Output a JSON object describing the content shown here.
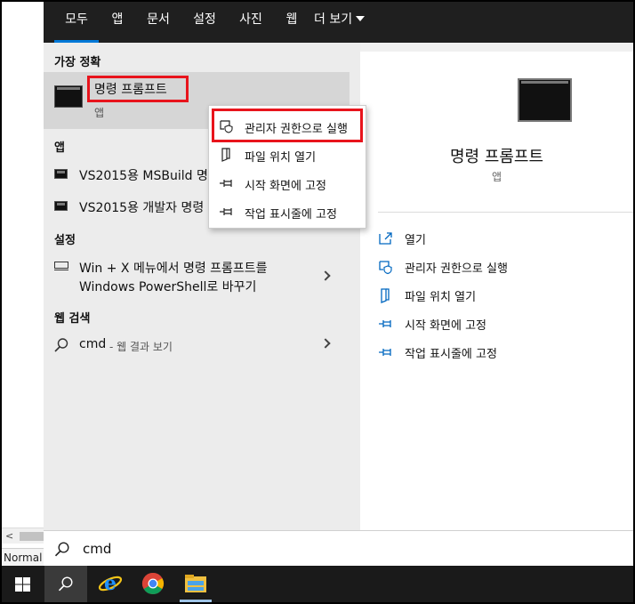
{
  "background_doc": {
    "scroll_left": "<",
    "status_text": "Normal t"
  },
  "tabs": [
    "모두",
    "앱",
    "문서",
    "설정",
    "사진",
    "웹",
    "더 보기"
  ],
  "left": {
    "best_match_title": "가장 정확",
    "best_match": {
      "name": "명령 프롬프트",
      "type": "앱"
    },
    "apps_title": "앱",
    "apps": [
      "VS2015용 MSBuild 명",
      "VS2015용 개발자 명령"
    ],
    "settings_title": "설정",
    "setting_line1": "Win + X 메뉴에서 명령 프롬프트를",
    "setting_line2": "Windows PowerShell로 바꾸기",
    "web_title": "웹 검색",
    "web_query": "cmd",
    "web_hint": "- 웹 결과 보기"
  },
  "context_menu": [
    "관리자 권한으로 실행",
    "파일 위치 열기",
    "시작 화면에 고정",
    "작업 표시줄에 고정"
  ],
  "preview": {
    "title": "명령 프롬프트",
    "subtitle": "앱",
    "actions": [
      {
        "label": "열기",
        "icon": "open-icon"
      },
      {
        "label": "관리자 권한으로 실행",
        "icon": "shield-icon"
      },
      {
        "label": "파일 위치 열기",
        "icon": "file-location-icon"
      },
      {
        "label": "시작 화면에 고정",
        "icon": "pin-icon"
      },
      {
        "label": "작업 표시줄에 고정",
        "icon": "pin-icon"
      }
    ]
  },
  "search": {
    "query": "cmd"
  },
  "taskbar": {
    "icons": [
      "windows-start-icon",
      "search-icon",
      "internet-explorer-icon",
      "chrome-icon",
      "file-explorer-icon"
    ]
  },
  "colors": {
    "accent": "#0078d7",
    "highlight": "#e8141c",
    "tabbar": "#1f1f1f",
    "taskbar": "#1a1a1a"
  }
}
